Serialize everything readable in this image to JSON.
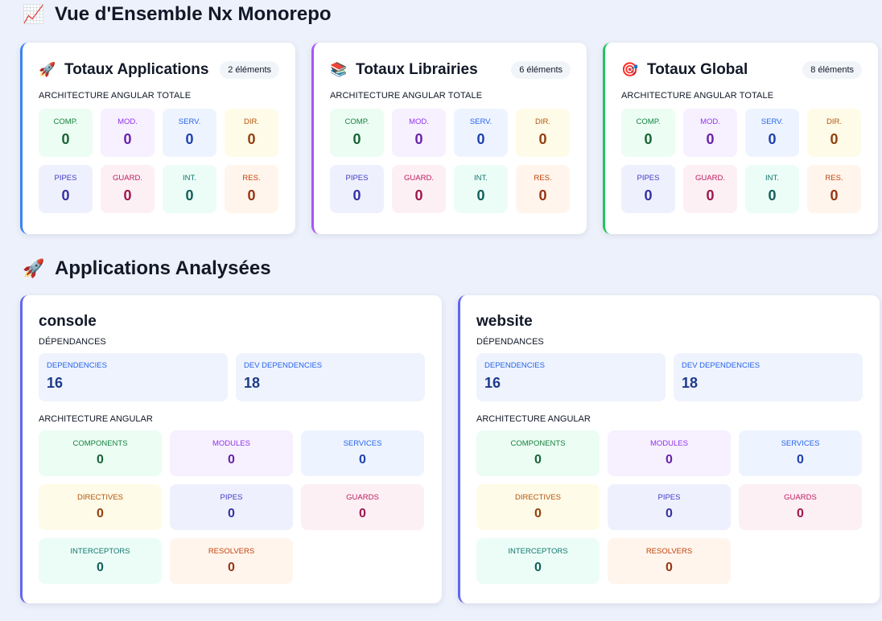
{
  "overview": {
    "title": "Vue d'Ensemble Nx Monorepo",
    "icon": "chart-increasing-icon"
  },
  "totals": [
    {
      "icon": "rocket-icon",
      "emoji": "🚀",
      "title": "Totaux Applications",
      "badge": "2 éléments",
      "accent": "#3b82f6",
      "subtitle": "ARCHITECTURE ANGULAR TOTALE",
      "stats": [
        {
          "label": "COMP.",
          "value": "0",
          "theme": "comp"
        },
        {
          "label": "MOD.",
          "value": "0",
          "theme": "mod"
        },
        {
          "label": "SERV.",
          "value": "0",
          "theme": "serv"
        },
        {
          "label": "DIR.",
          "value": "0",
          "theme": "dir"
        },
        {
          "label": "PIPES",
          "value": "0",
          "theme": "pipes"
        },
        {
          "label": "GUARD.",
          "value": "0",
          "theme": "guard"
        },
        {
          "label": "INT.",
          "value": "0",
          "theme": "int"
        },
        {
          "label": "RES.",
          "value": "0",
          "theme": "res"
        }
      ]
    },
    {
      "icon": "books-icon",
      "emoji": "📚",
      "title": "Totaux Librairies",
      "badge": "6 éléments",
      "accent": "#a855f7",
      "subtitle": "ARCHITECTURE ANGULAR TOTALE",
      "stats": [
        {
          "label": "COMP.",
          "value": "0",
          "theme": "comp"
        },
        {
          "label": "MOD.",
          "value": "0",
          "theme": "mod"
        },
        {
          "label": "SERV.",
          "value": "0",
          "theme": "serv"
        },
        {
          "label": "DIR.",
          "value": "0",
          "theme": "dir"
        },
        {
          "label": "PIPES",
          "value": "0",
          "theme": "pipes"
        },
        {
          "label": "GUARD.",
          "value": "0",
          "theme": "guard"
        },
        {
          "label": "INT.",
          "value": "0",
          "theme": "int"
        },
        {
          "label": "RES.",
          "value": "0",
          "theme": "res"
        }
      ]
    },
    {
      "icon": "target-icon",
      "emoji": "🎯",
      "title": "Totaux Global",
      "badge": "8 éléments",
      "accent": "#22c55e",
      "subtitle": "ARCHITECTURE ANGULAR TOTALE",
      "stats": [
        {
          "label": "COMP.",
          "value": "0",
          "theme": "comp"
        },
        {
          "label": "MOD.",
          "value": "0",
          "theme": "mod"
        },
        {
          "label": "SERV.",
          "value": "0",
          "theme": "serv"
        },
        {
          "label": "DIR.",
          "value": "0",
          "theme": "dir"
        },
        {
          "label": "PIPES",
          "value": "0",
          "theme": "pipes"
        },
        {
          "label": "GUARD.",
          "value": "0",
          "theme": "guard"
        },
        {
          "label": "INT.",
          "value": "0",
          "theme": "int"
        },
        {
          "label": "RES.",
          "value": "0",
          "theme": "res"
        }
      ]
    }
  ],
  "apps_section": {
    "title": "Applications Analysées",
    "icon": "rocket-icon"
  },
  "apps": [
    {
      "name": "console",
      "deps_label": "DÉPENDANCES",
      "dependencies_label": "DEPENDENCIES",
      "dependencies": "16",
      "dev_dependencies_label": "DEV DEPENDENCIES",
      "dev_dependencies": "18",
      "arch_label": "ARCHITECTURE ANGULAR",
      "stats": [
        {
          "label": "COMPONENTS",
          "value": "0",
          "theme": "comp"
        },
        {
          "label": "MODULES",
          "value": "0",
          "theme": "mod"
        },
        {
          "label": "SERVICES",
          "value": "0",
          "theme": "serv"
        },
        {
          "label": "DIRECTIVES",
          "value": "0",
          "theme": "dir"
        },
        {
          "label": "PIPES",
          "value": "0",
          "theme": "pipes"
        },
        {
          "label": "GUARDS",
          "value": "0",
          "theme": "guard"
        },
        {
          "label": "INTERCEPTORS",
          "value": "0",
          "theme": "int"
        },
        {
          "label": "RESOLVERS",
          "value": "0",
          "theme": "res"
        }
      ]
    },
    {
      "name": "website",
      "deps_label": "DÉPENDANCES",
      "dependencies_label": "DEPENDENCIES",
      "dependencies": "16",
      "dev_dependencies_label": "DEV DEPENDENCIES",
      "dev_dependencies": "18",
      "arch_label": "ARCHITECTURE ANGULAR",
      "stats": [
        {
          "label": "COMPONENTS",
          "value": "0",
          "theme": "comp"
        },
        {
          "label": "MODULES",
          "value": "0",
          "theme": "mod"
        },
        {
          "label": "SERVICES",
          "value": "0",
          "theme": "serv"
        },
        {
          "label": "DIRECTIVES",
          "value": "0",
          "theme": "dir"
        },
        {
          "label": "PIPES",
          "value": "0",
          "theme": "pipes"
        },
        {
          "label": "GUARDS",
          "value": "0",
          "theme": "guard"
        },
        {
          "label": "INTERCEPTORS",
          "value": "0",
          "theme": "int"
        },
        {
          "label": "RESOLVERS",
          "value": "0",
          "theme": "res"
        }
      ]
    }
  ]
}
